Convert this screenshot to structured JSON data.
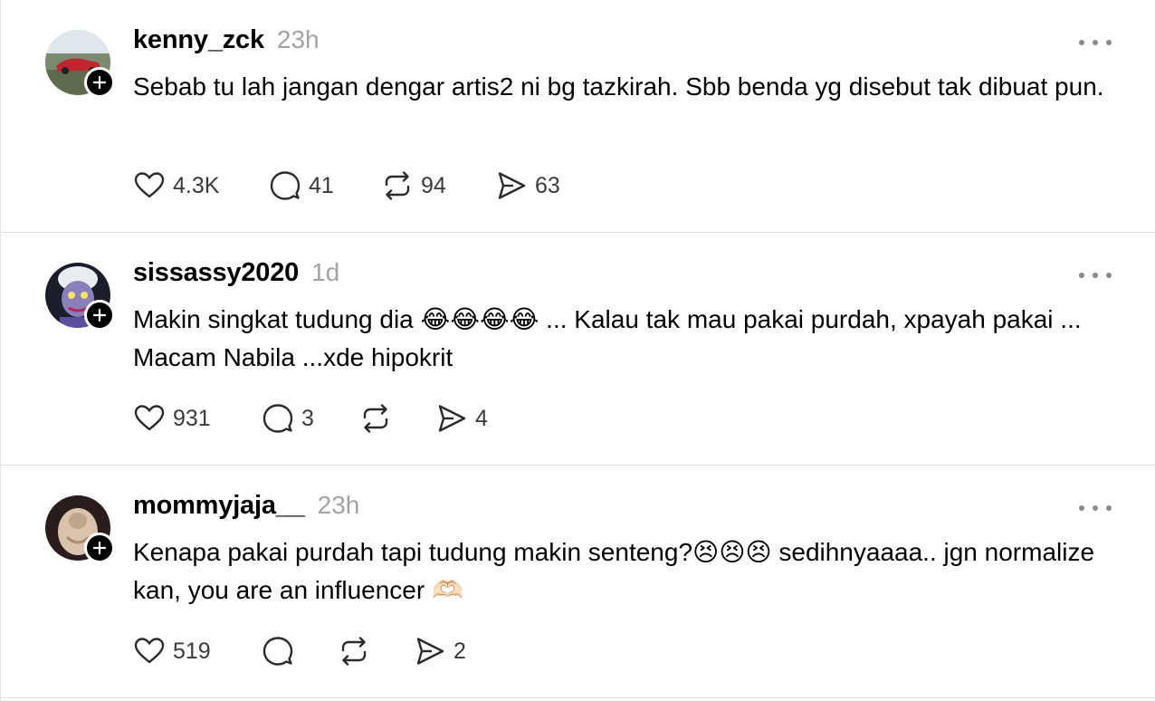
{
  "posts": [
    {
      "username": "kenny_zck",
      "time": "23h",
      "text": "Sebab tu lah jangan dengar artis2 ni bg tazkirah. Sbb benda yg disebut tak dibuat pun.",
      "likes": "4.3K",
      "replies": "41",
      "reposts": "94",
      "shares": "63",
      "avatar_icon": "profile-photo-red-car"
    },
    {
      "username": "sissassy2020",
      "time": "1d",
      "text": "Makin singkat tudung dia 😂😂😂😂 ... Kalau tak mau pakai purdah, xpayah pakai ... Macam Nabila ...xde hipokrit",
      "likes": "931",
      "replies": "3",
      "reposts": "",
      "shares": "4",
      "avatar_icon": "profile-photo-cartoon-character"
    },
    {
      "username": "mommyjaja__",
      "time": "23h",
      "text": "Kenapa pakai purdah tapi tudung makin senteng?😣😣😣 sedihnyaaaa.. jgn normalize kan, you are an influencer 🫶🏻",
      "likes": "519",
      "replies": "",
      "reposts": "",
      "shares": "2",
      "avatar_icon": "profile-photo-person"
    }
  ],
  "colors": {
    "text": "#000000",
    "muted": "#a3a3a3",
    "icon": "#3a3a3a",
    "divider": "#e0e0e0"
  }
}
